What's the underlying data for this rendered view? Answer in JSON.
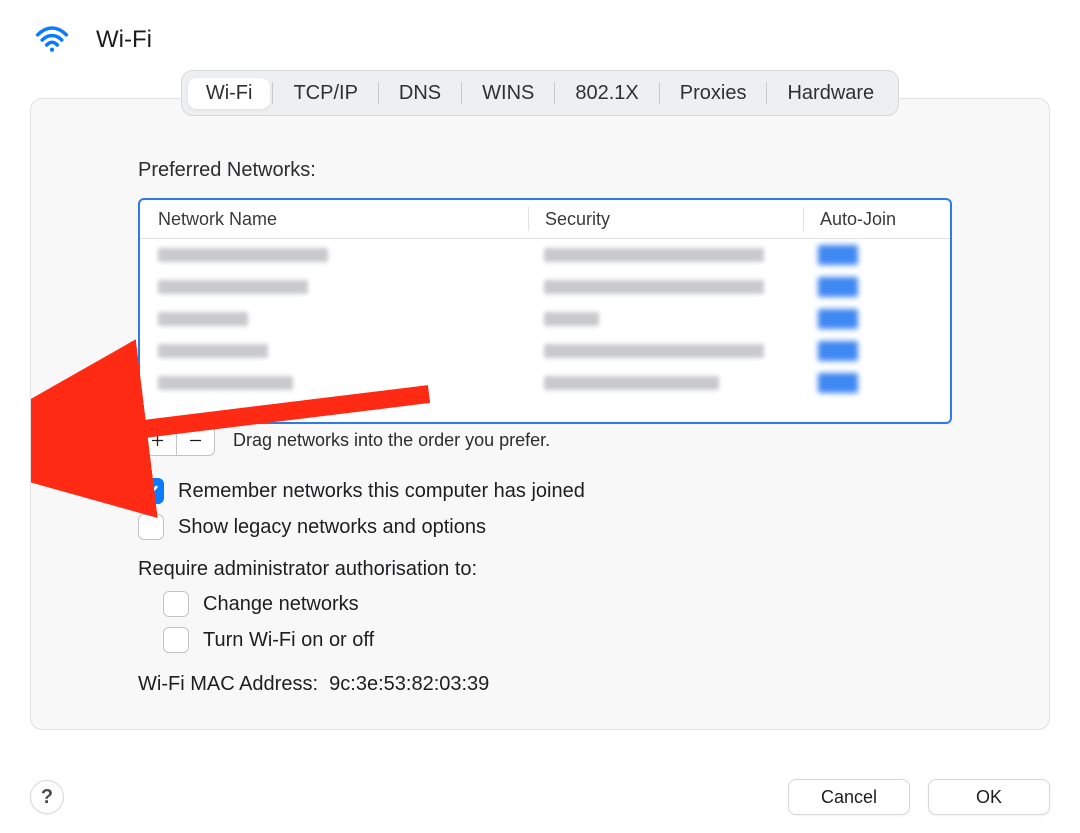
{
  "header": {
    "title": "Wi-Fi"
  },
  "tabs": {
    "items": [
      {
        "label": "Wi-Fi",
        "active": true
      },
      {
        "label": "TCP/IP"
      },
      {
        "label": "DNS"
      },
      {
        "label": "WINS"
      },
      {
        "label": "802.1X"
      },
      {
        "label": "Proxies"
      },
      {
        "label": "Hardware"
      }
    ]
  },
  "preferred": {
    "label": "Preferred Networks:",
    "columns": {
      "network": "Network Name",
      "security": "Security",
      "autojoin": "Auto-Join"
    },
    "rows": [
      {
        "network_blur_w": 170,
        "security_blur_w": 220,
        "autojoin": true
      },
      {
        "network_blur_w": 150,
        "security_blur_w": 220,
        "autojoin": true
      },
      {
        "network_blur_w": 90,
        "security_blur_w": 55,
        "autojoin": true
      },
      {
        "network_blur_w": 110,
        "security_blur_w": 220,
        "autojoin": true
      },
      {
        "network_blur_w": 135,
        "security_blur_w": 175,
        "autojoin": true
      }
    ],
    "drag_hint": "Drag networks into the order you prefer."
  },
  "options": {
    "remember": {
      "label": "Remember networks this computer has joined",
      "checked": true
    },
    "legacy": {
      "label": "Show legacy networks and options",
      "checked": false
    },
    "admin_label": "Require administrator authorisation to:",
    "change_networks": {
      "label": "Change networks",
      "checked": false
    },
    "turn_wifi": {
      "label": "Turn Wi-Fi on or off",
      "checked": false
    }
  },
  "mac": {
    "label": "Wi-Fi MAC Address:",
    "value": "9c:3e:53:82:03:39"
  },
  "footer": {
    "help": "?",
    "cancel": "Cancel",
    "ok": "OK"
  }
}
